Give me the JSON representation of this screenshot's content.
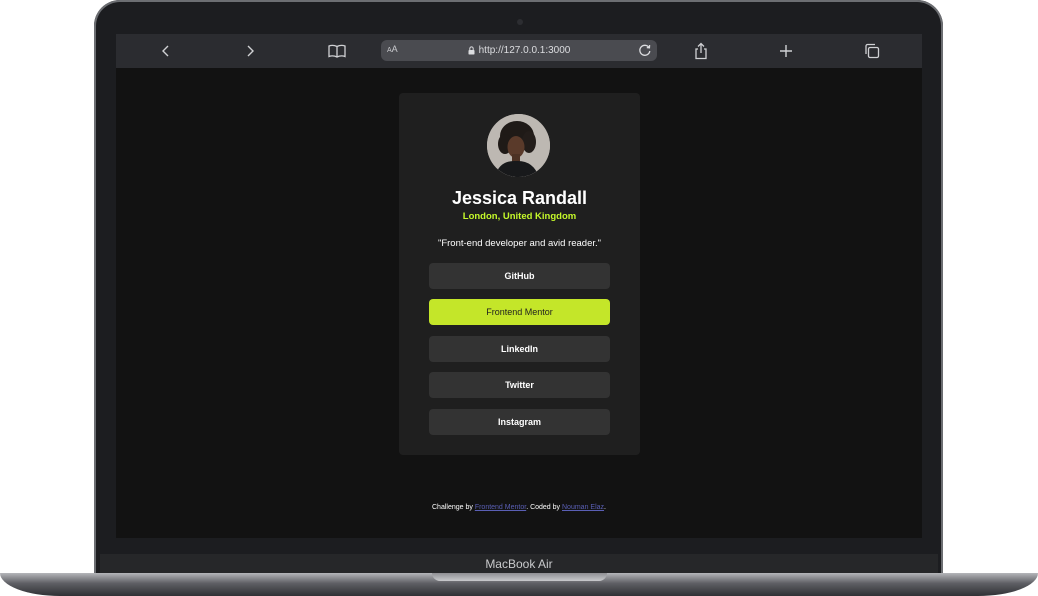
{
  "device": {
    "label": "MacBook Air"
  },
  "browser": {
    "text_size_label_small": "A",
    "text_size_label_large": "A",
    "url": "http://127.0.0.1:3000",
    "icons": [
      "chevron-left-icon",
      "chevron-right-icon",
      "book-icon",
      "lock-icon",
      "reload-icon",
      "share-icon",
      "plus-icon",
      "tabs-icon"
    ]
  },
  "profile": {
    "name": "Jessica Randall",
    "location": "London, United Kingdom",
    "bio": "\"Front-end developer and avid reader.\""
  },
  "links": [
    {
      "label": "GitHub",
      "active": false
    },
    {
      "label": "Frontend Mentor",
      "active": true
    },
    {
      "label": "LinkedIn",
      "active": false
    },
    {
      "label": "Twitter",
      "active": false
    },
    {
      "label": "Instagram",
      "active": false
    }
  ],
  "attribution": {
    "prefix": "Challenge by ",
    "challenge_link": "Frontend Mentor",
    "middle": ". Coded by ",
    "author_link": "Nouman Elaz",
    "suffix": "."
  },
  "colors": {
    "accent": "#c4f82a",
    "button_active": "#c4e629",
    "card": "#1f1f1f",
    "button": "#333333",
    "page_bg": "#121212"
  }
}
